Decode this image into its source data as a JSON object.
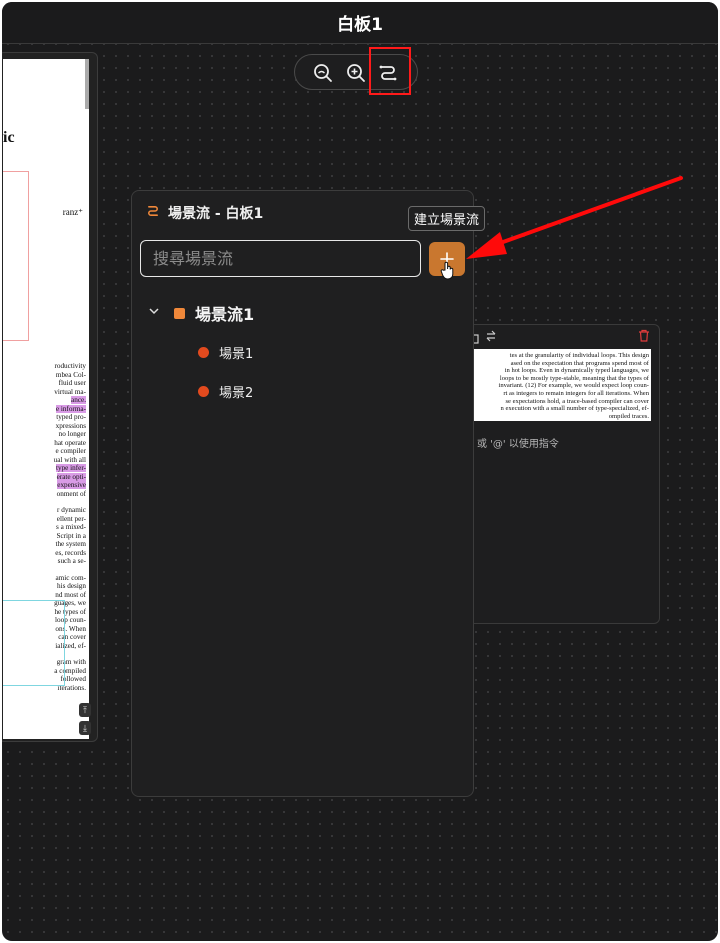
{
  "window": {
    "title": "白板1"
  },
  "toolbar": {
    "icons": [
      "zoom-out-icon",
      "zoom-in-icon",
      "scene-flow-icon"
    ]
  },
  "panel": {
    "title": "場景流 - 白板1",
    "search_placeholder": "搜尋場景流",
    "add_tooltip": "建立場景流",
    "groups": [
      {
        "name": "場景流1",
        "color": "#f0883a",
        "items": [
          {
            "name": "場景1",
            "color": "#e24a1e"
          },
          {
            "name": "場景2",
            "color": "#e24a1e"
          }
        ]
      }
    ]
  },
  "note_card": {
    "hint": "或 '@' 以使用指令",
    "page_lines": [
      "tes at the granularity of individual loops. This design",
      "ased on the expectation that programs spend most of",
      "in hot loops. Even in dynamically typed languages, we",
      "loops to be mostly type-stable, meaning that the types of",
      "invariant. (12) For example, we would expect loop coun-",
      "rt as integers to remain integers for all iterations. When",
      "se expectations hold, a trace-based compiler can cover",
      "n execution with a small number of type-specialized, ef-",
      "ompiled traces."
    ]
  },
  "doc_card": {
    "heading": "ic",
    "author": "ranz⁺",
    "lines": [
      "roductivity",
      "mbea Col-",
      "fluid user",
      "virtual ma-",
      "ance.",
      "e informa-",
      "typed pro-",
      "xpressions",
      "no longer",
      "hat operate",
      "e compiler",
      "ual with all",
      "type infer-",
      "erate opti-",
      "expensive",
      "onment of",
      "",
      "r dynamic",
      "ellent per-",
      "s a mixed-",
      "Script in a",
      "the system",
      "es, records",
      "such a se-",
      "",
      "amic com-",
      "his design",
      "nd most of",
      "guages, we",
      "he types of",
      "loop coun-",
      "ons. When",
      "can cover",
      "ialized, ef-",
      "",
      "gram with",
      "a compiled",
      "followed",
      "iterations."
    ],
    "highlighted": [
      4,
      5,
      12,
      13,
      14
    ]
  }
}
